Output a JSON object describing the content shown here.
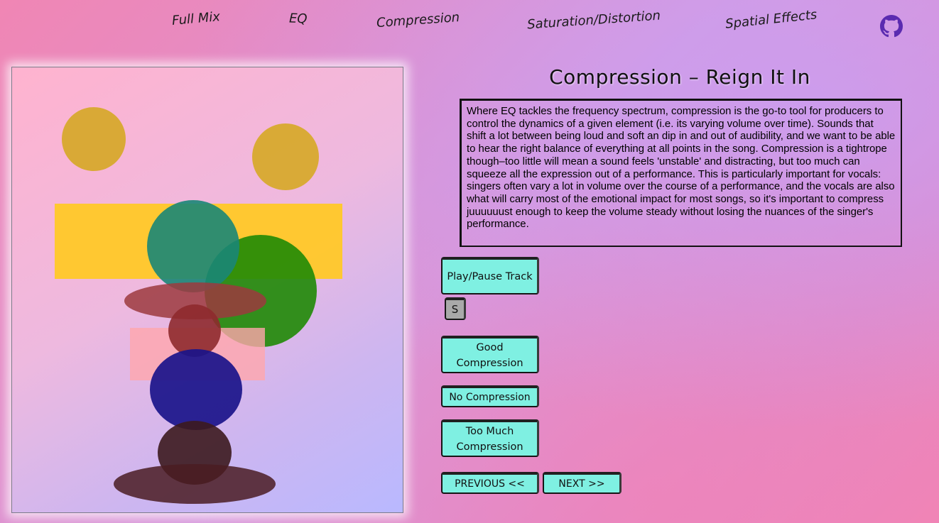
{
  "nav": {
    "full_mix": "Full Mix",
    "eq": "EQ",
    "compression": "Compression",
    "saturation": "Saturation/Distortion",
    "spatial": "Spatial Effects",
    "github_icon": "github-icon"
  },
  "main": {
    "title": "Compression – Reign It In",
    "description": "Where EQ tackles the frequency spectrum, compression is the go-to tool for producers to control the dynamics of a given element (i.e. its varying volume over time). Sounds that shift a lot between being loud and soft an dip in and out of audibility, and we want to be able to hear the right balance of everything at all points in the song. Compression is a tightrope though–too little will mean a sound feels 'unstable' and distracting, but too much can squeeze all the expression out of a performance. This is particularly important for vocals: singers often vary a lot in volume over the course of a performance, and the vocals are also what will carry most of the emotional impact for most songs, so it's important to compress juuuuuust enough to keep the volume steady without losing the nuances of the singer's performance."
  },
  "controls": {
    "play_pause": "Play/Pause Track",
    "s_label": "S",
    "good": "Good Compression",
    "none": "No Compression",
    "too_much": "Too Much Compression",
    "previous": "PREVIOUS <<",
    "next": "NEXT >>"
  },
  "colors": {
    "button_bg": "#7ff0e2",
    "s_button_bg": "#a9a9a9",
    "ochre": "#d7a92d",
    "yellow": "#ffc82b",
    "teal": "#2e8e74",
    "green": "#2f8e14",
    "maroon": "#9c3a3e",
    "blush": "#ffa6ac",
    "navy": "#271f8c",
    "dark_brown": "#4a2327"
  }
}
